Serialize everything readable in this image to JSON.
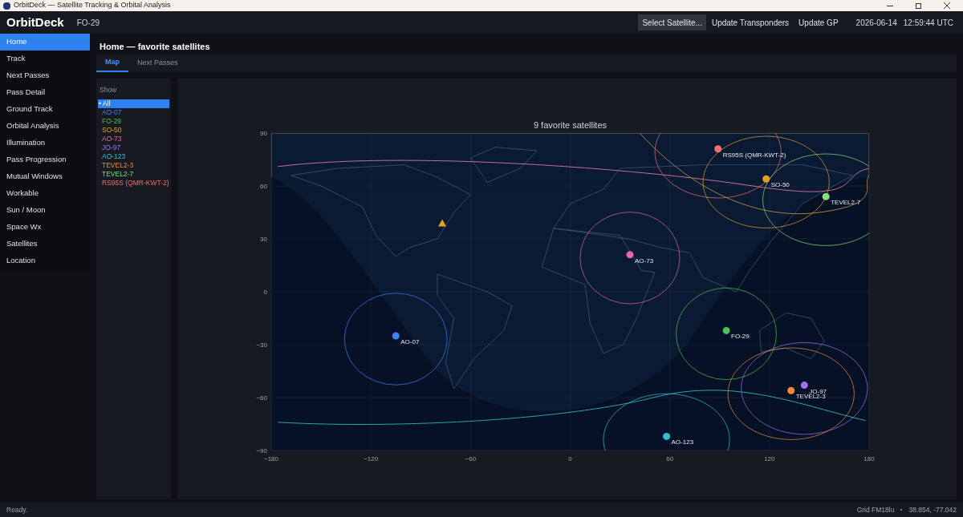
{
  "window": {
    "title": "OrbitDeck — Satellite Tracking & Orbital Analysis"
  },
  "header": {
    "app_name": "OrbitDeck",
    "current_satellite": "FO-29",
    "buttons": [
      {
        "label": "Select Satellite...",
        "selected": true
      },
      {
        "label": "Update Transponders",
        "selected": false
      },
      {
        "label": "Update GP",
        "selected": false
      }
    ],
    "date": "2026-06-14",
    "time": "12:59:44 UTC"
  },
  "sidebar": {
    "items": [
      {
        "label": "Home",
        "selected": true
      },
      {
        "label": "Track",
        "selected": false
      },
      {
        "label": "Next Passes",
        "selected": false
      },
      {
        "label": "Pass Detail",
        "selected": false
      },
      {
        "label": "Ground Track",
        "selected": false
      },
      {
        "label": "Orbital Analysis",
        "selected": false
      },
      {
        "label": "Illumination",
        "selected": false
      },
      {
        "label": "Pass Progression",
        "selected": false
      },
      {
        "label": "Mutual Windows",
        "selected": false
      },
      {
        "label": "Workable",
        "selected": false
      },
      {
        "label": "Sun / Moon",
        "selected": false
      },
      {
        "label": "Space Wx",
        "selected": false
      },
      {
        "label": "Satellites",
        "selected": false
      },
      {
        "label": "Location",
        "selected": false
      }
    ]
  },
  "page": {
    "title": "Home — favorite satellites",
    "tabs": [
      {
        "label": "Map",
        "selected": true
      },
      {
        "label": "Next Passes",
        "selected": false
      }
    ]
  },
  "show_list": {
    "heading": "Show",
    "items": [
      {
        "label": "• All",
        "selected": true
      },
      {
        "label": "AO-07",
        "selected": false
      },
      {
        "label": "FO-29",
        "selected": false
      },
      {
        "label": "SO-50",
        "selected": false
      },
      {
        "label": "AO-73",
        "selected": false
      },
      {
        "label": "JO-97",
        "selected": false
      },
      {
        "label": "AO-123",
        "selected": false
      },
      {
        "label": "TEVEL2-3",
        "selected": false
      },
      {
        "label": "TEVEL2-7",
        "selected": false
      },
      {
        "label": "RS95S (QMR-KWT-2)",
        "selected": false
      }
    ]
  },
  "map": {
    "chart_data": {
      "type": "scatter",
      "title": "9 favorite satellites",
      "grid": true,
      "xlim": [
        -180,
        180
      ],
      "ylim": [
        -90,
        90
      ],
      "xticks": [
        {
          "value": -180,
          "label": "−180"
        },
        {
          "value": -120,
          "label": "−120"
        },
        {
          "value": -60,
          "label": "−60"
        },
        {
          "value": 0,
          "label": "0"
        },
        {
          "value": 60,
          "label": "60"
        },
        {
          "value": 120,
          "label": "120"
        },
        {
          "value": 180,
          "label": "180"
        }
      ],
      "yticks": [
        {
          "value": -90,
          "label": "−90"
        },
        {
          "value": -60,
          "label": "−60"
        },
        {
          "value": -30,
          "label": "−30"
        },
        {
          "value": 0,
          "label": "0"
        },
        {
          "value": 30,
          "label": "30"
        },
        {
          "value": 60,
          "label": "60"
        },
        {
          "value": 90,
          "label": "90"
        }
      ],
      "series": [
        {
          "name": "AO-07",
          "color": "#3b82f6",
          "x": [
            -105
          ],
          "values": [
            -25
          ]
        },
        {
          "name": "FO-29",
          "color": "#4cc05a",
          "x": [
            94
          ],
          "values": [
            -22
          ]
        },
        {
          "name": "SO-50",
          "color": "#e0a028",
          "x": [
            118
          ],
          "values": [
            64
          ]
        },
        {
          "name": "AO-73",
          "color": "#e066a8",
          "x": [
            36
          ],
          "values": [
            21
          ]
        },
        {
          "name": "JO-97",
          "color": "#a070f0",
          "x": [
            141
          ],
          "values": [
            -53
          ]
        },
        {
          "name": "AO-123",
          "color": "#30c0d0",
          "x": [
            58
          ],
          "values": [
            -82
          ]
        },
        {
          "name": "TEVEL2-3",
          "color": "#f08a3a",
          "x": [
            133
          ],
          "values": [
            -56
          ]
        },
        {
          "name": "TEVEL2-7",
          "color": "#7ee07e",
          "x": [
            154
          ],
          "values": [
            54
          ]
        },
        {
          "name": "RS95S (QMR-KWT-2)",
          "color": "#f07070",
          "x": [
            89
          ],
          "values": [
            81
          ]
        }
      ]
    }
  },
  "status_bar": {
    "message": "Ready.",
    "grid": "Grid FM18lu",
    "coordinates": "38.854, -77.042"
  }
}
